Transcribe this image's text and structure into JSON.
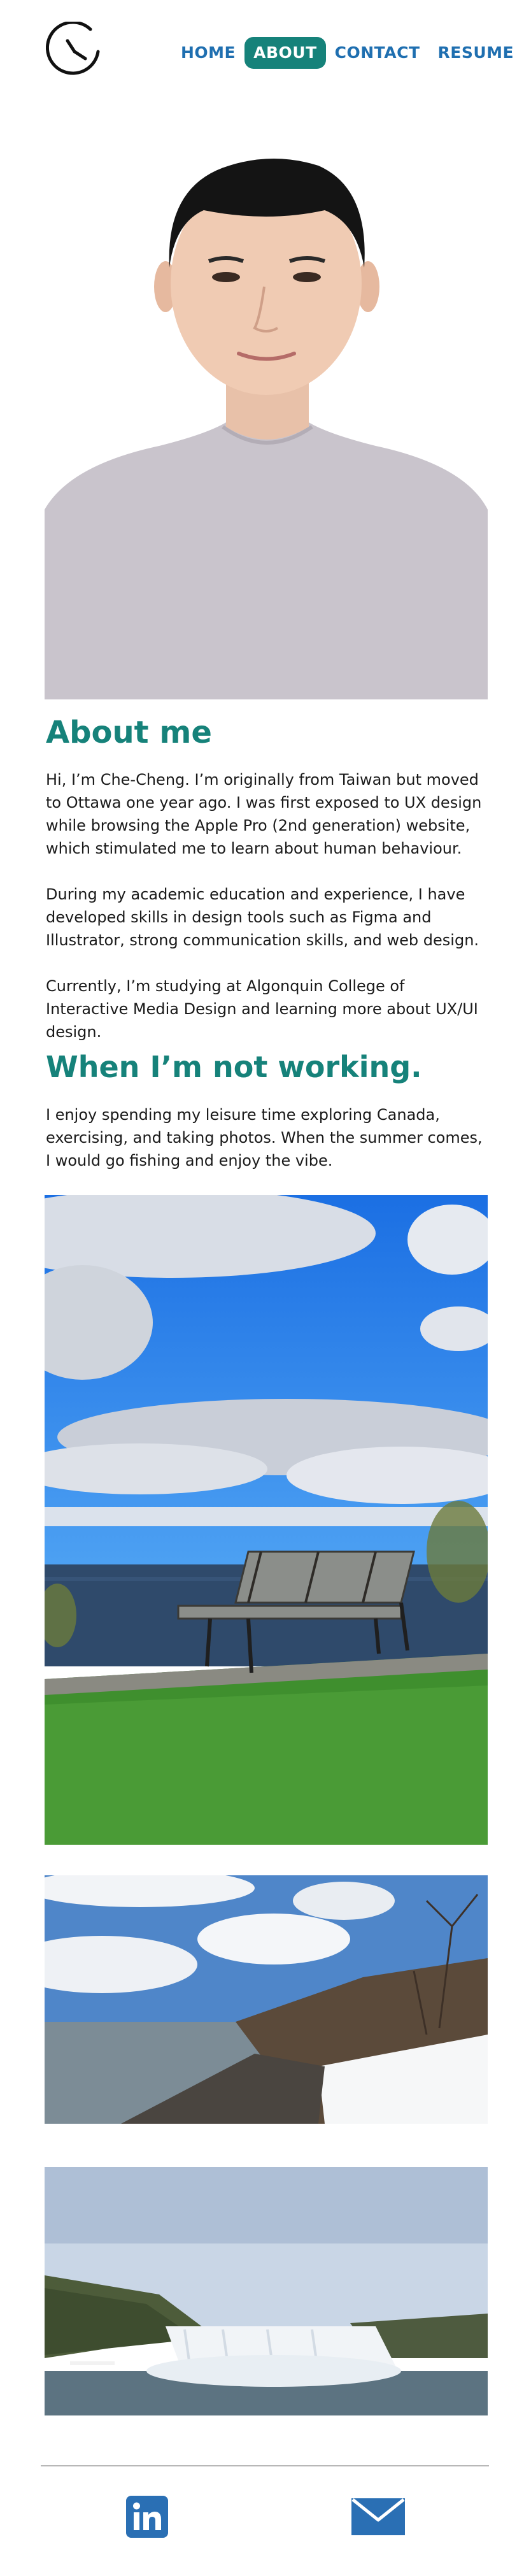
{
  "nav": {
    "items": [
      "HOME",
      "ABOUT",
      "CONTACT",
      "RESUME"
    ],
    "active": "ABOUT"
  },
  "about": {
    "title": "About me",
    "paragraphs": [
      "Hi, I’m Che-Cheng. I’m originally from Taiwan but moved to Ottawa one year ago. I was first exposed to UX design while browsing the Apple Pro (2nd generation) website, which stimulated me to learn about human behaviour.",
      "During my academic education and experience, I have developed skills in design tools such as Figma and Illustrator, strong communication skills, and web design.",
      "Currently, I’m studying at Algonquin College of Interactive Media Design and learning more about UX/UI design."
    ]
  },
  "leisure": {
    "title": "When I’m not working.",
    "paragraph": "I enjoy spending my leisure time exploring Canada, exercising, and taking photos. When the summer comes, I would go fishing and enjoy the vibe."
  },
  "colors": {
    "accent": "#16827a",
    "nav_link": "#1f6fb0",
    "linkedin": "#2a6fb4",
    "mail": "#2a6fb4"
  },
  "icons": [
    "clock-logo-icon",
    "linkedin-icon",
    "mail-icon"
  ]
}
